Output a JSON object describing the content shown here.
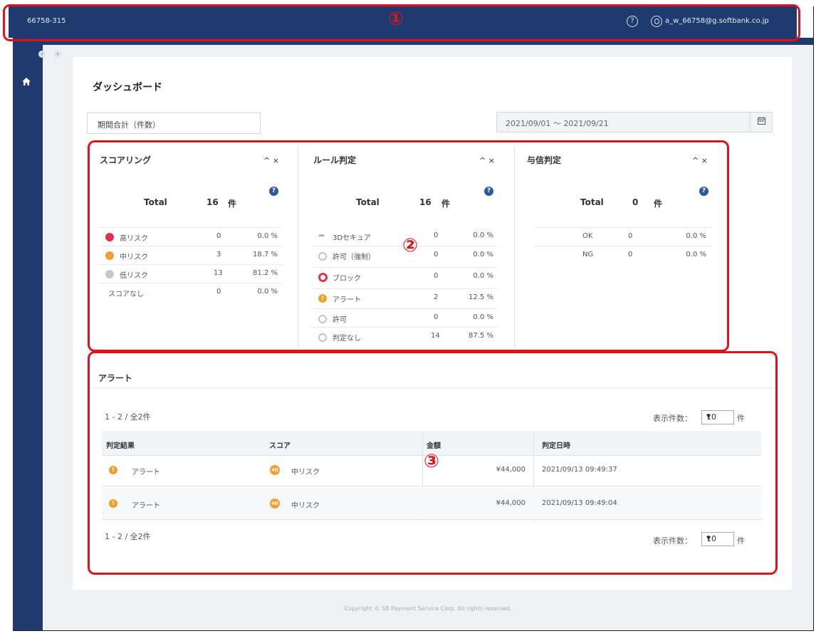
{
  "topbar": {
    "account_id": "66758-315",
    "help_glyph": "?",
    "user_email": "a_w_66758@g.softbank.co.jp"
  },
  "sidebar": {
    "toggle_left": "‹",
    "toggle_right": "›"
  },
  "page": {
    "title": "ダッシュボード"
  },
  "filters": {
    "period_select": "期間合計（件数）",
    "date_range": "2021/09/01 ～ 2021/09/21"
  },
  "panels": {
    "ctrl": "^ ×",
    "total_label": "Total",
    "unit": "件",
    "scoring": {
      "title": "スコアリング",
      "total": "16",
      "rows": [
        {
          "label": "高リスク",
          "count": "0",
          "pct": "0.0 %"
        },
        {
          "label": "中リスク",
          "count": "3",
          "pct": "18.7 %"
        },
        {
          "label": "低リスク",
          "count": "13",
          "pct": "81.2 %"
        },
        {
          "label": "スコアなし",
          "count": "0",
          "pct": "0.0 %"
        }
      ]
    },
    "rule": {
      "title": "ルール判定",
      "total": "16",
      "rows": [
        {
          "label": "3Dセキュア",
          "count": "0",
          "pct": "0.0 %"
        },
        {
          "label": "許可（強制）",
          "count": "0",
          "pct": "0.0 %"
        },
        {
          "label": "ブロック",
          "count": "0",
          "pct": "0.0 %"
        },
        {
          "label": "アラート",
          "count": "2",
          "pct": "12.5 %"
        },
        {
          "label": "許可",
          "count": "0",
          "pct": "0.0 %"
        },
        {
          "label": "判定なし",
          "count": "14",
          "pct": "87.5 %"
        }
      ]
    },
    "credit": {
      "title": "与信判定",
      "total": "0",
      "rows": [
        {
          "label": "OK",
          "count": "0",
          "pct": "0.0 %"
        },
        {
          "label": "NG",
          "count": "0",
          "pct": "0.0 %"
        }
      ]
    }
  },
  "alerts": {
    "title": "アラート",
    "range_text": "1 - 2 / 全2件",
    "per_page_label": "表示件数：",
    "per_page_value": "10",
    "per_page_unit": "件",
    "columns": [
      "判定結果",
      "スコア",
      "金額",
      "判定日時"
    ],
    "rows": [
      {
        "result": "アラート",
        "score_badge": "40",
        "score": "中リスク",
        "amount": "¥44,000",
        "datetime": "2021/09/13 09:49:37"
      },
      {
        "result": "アラート",
        "score_badge": "40",
        "score": "中リスク",
        "amount": "¥44,000",
        "datetime": "2021/09/13 09:49:04"
      }
    ]
  },
  "footer": {
    "copyright": "Copyright © SB Payment Service Corp. All rights reserved."
  },
  "markers": [
    "①",
    "②",
    "③"
  ],
  "colors": {
    "navy": "#1e3a6e",
    "high_risk": "#e0334a",
    "mid_risk": "#f0a030",
    "low_risk": "#c8c8c8",
    "info_blue": "#2c5aa0",
    "annotation_red": "#e0131a"
  },
  "icons": [
    "help-icon",
    "user-icon",
    "home-icon",
    "calendar-icon",
    "info-icon",
    "arrow-icon",
    "circle-icon",
    "block-icon",
    "alert-icon"
  ]
}
